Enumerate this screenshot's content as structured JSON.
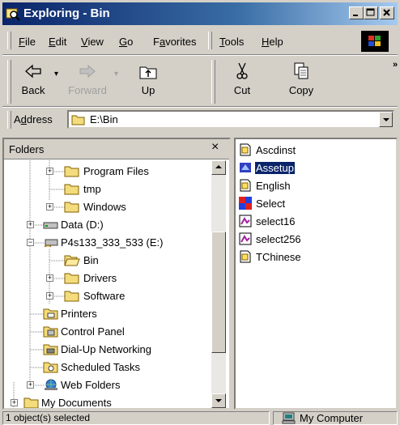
{
  "window": {
    "title": "Exploring - Bin"
  },
  "menu": [
    {
      "label": "File",
      "key": "F",
      "rest": "ile"
    },
    {
      "label": "Edit",
      "key": "E",
      "rest": "dit"
    },
    {
      "label": "View",
      "key": "V",
      "rest": "iew"
    },
    {
      "label": "Go",
      "key": "G",
      "rest": "o"
    },
    {
      "label": "Favorites",
      "key": "a",
      "pre": "F",
      "rest": "vorites"
    },
    {
      "label": "Tools",
      "key": "T",
      "rest": "ools"
    },
    {
      "label": "Help",
      "key": "H",
      "rest": "elp"
    }
  ],
  "toolbar": {
    "back": "Back",
    "forward": "Forward",
    "up": "Up",
    "cut": "Cut",
    "copy": "Copy",
    "more": "»"
  },
  "address": {
    "label": "Address",
    "label_key": "d",
    "label_pre": "A",
    "label_rest": "dress",
    "value": "E:\\Bin"
  },
  "folders": {
    "header": "Folders",
    "close": "×",
    "items": [
      {
        "label": "Program Files",
        "pm": "+"
      },
      {
        "label": "tmp",
        "pm": ""
      },
      {
        "label": "Windows",
        "pm": "+"
      },
      {
        "label": "Data (D:)",
        "pm": "+"
      },
      {
        "label": "P4s133_333_533 (E:)",
        "pm": "−"
      },
      {
        "label": "Bin",
        "pm": ""
      },
      {
        "label": "Drivers",
        "pm": "+"
      },
      {
        "label": "Software",
        "pm": "+"
      },
      {
        "label": "Printers",
        "pm": ""
      },
      {
        "label": "Control Panel",
        "pm": ""
      },
      {
        "label": "Dial-Up Networking",
        "pm": ""
      },
      {
        "label": "Scheduled Tasks",
        "pm": ""
      },
      {
        "label": "Web Folders",
        "pm": "+"
      },
      {
        "label": "My Documents",
        "pm": "+"
      }
    ]
  },
  "files": [
    {
      "label": "Ascdinst",
      "icon": "ini-file-icon"
    },
    {
      "label": "Assetup",
      "icon": "setup-app-icon",
      "selected": true
    },
    {
      "label": "English",
      "icon": "ini-file-icon"
    },
    {
      "label": "Select",
      "icon": "select-app-icon"
    },
    {
      "label": "select16",
      "icon": "image-file-icon"
    },
    {
      "label": "select256",
      "icon": "image-file-icon"
    },
    {
      "label": "TChinese",
      "icon": "ini-file-icon"
    }
  ],
  "status": {
    "left": "1 object(s) selected",
    "right": "My Computer"
  },
  "colors": {
    "title_bar": "#0a246a",
    "selection": "#0a246a",
    "face": "#d4d0c8"
  }
}
